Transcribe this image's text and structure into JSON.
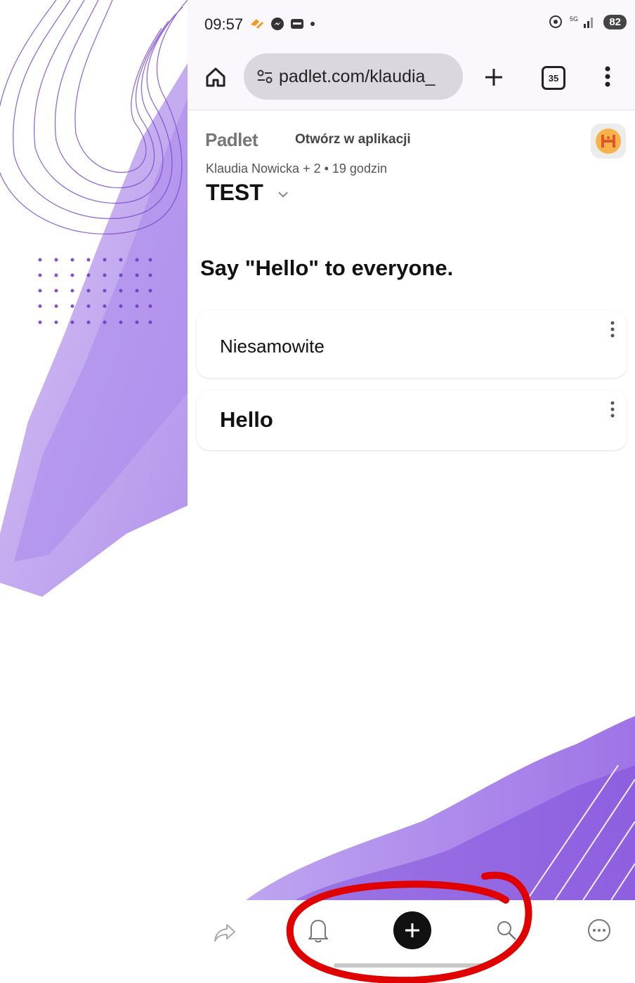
{
  "status_bar": {
    "time": "09:57",
    "battery": "82"
  },
  "browser": {
    "url": "padlet.com/klaudia_",
    "tab_count": "35"
  },
  "padlet": {
    "logo": "Padlet",
    "open_in_app": "Otwórz w aplikacji",
    "meta": "Klaudia Nowicka + 2 • 19 godzin",
    "board_title": "TEST",
    "section_title": "Say \"Hello\" to everyone.",
    "posts": [
      {
        "text": "Niesamowite"
      },
      {
        "text": "Hello"
      }
    ]
  },
  "bottom_nav": {
    "items": [
      "share-icon",
      "bell-icon",
      "add-icon",
      "search-icon",
      "more-icon"
    ]
  },
  "colors": {
    "accent_purple": "#8a5ce0",
    "annotation_red": "#e00000"
  }
}
